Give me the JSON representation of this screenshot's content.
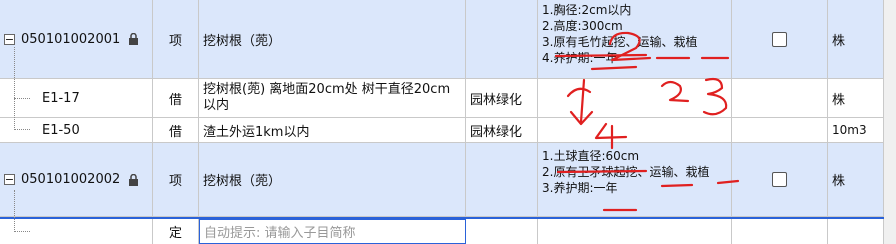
{
  "rows": [
    {
      "code": "050101002001",
      "type": "项",
      "name": "挖树根（蔸）",
      "desc": [
        "1.胸径:2cm以内",
        "2.高度:300cm",
        "3.原有毛竹起挖、运输、栽植",
        "4.养护期:一年"
      ],
      "unit": "株"
    },
    {
      "code": "E1-17",
      "type": "借",
      "name": "挖树根(蔸) 离地面20cm处 树干直径20cm以内",
      "category": "园林绿化",
      "unit": "株"
    },
    {
      "code": "E1-50",
      "type": "借",
      "name": "渣土外运1km以内",
      "category": "园林绿化",
      "unit": "10m3"
    },
    {
      "code": "050101002002",
      "type": "项",
      "name": "挖树根（蔸）",
      "desc": [
        "1.土球直径:60cm",
        "2.原有卫矛球起挖、运输、栽植",
        "3.养护期:一年"
      ],
      "unit": "株"
    },
    {
      "type": "定",
      "hint": "自动提示: 请输入子目简称"
    }
  ],
  "collapse_symbol": "−",
  "annotations": {
    "marks": [
      "1",
      "2",
      "3",
      "4"
    ],
    "color": "#e02020"
  }
}
